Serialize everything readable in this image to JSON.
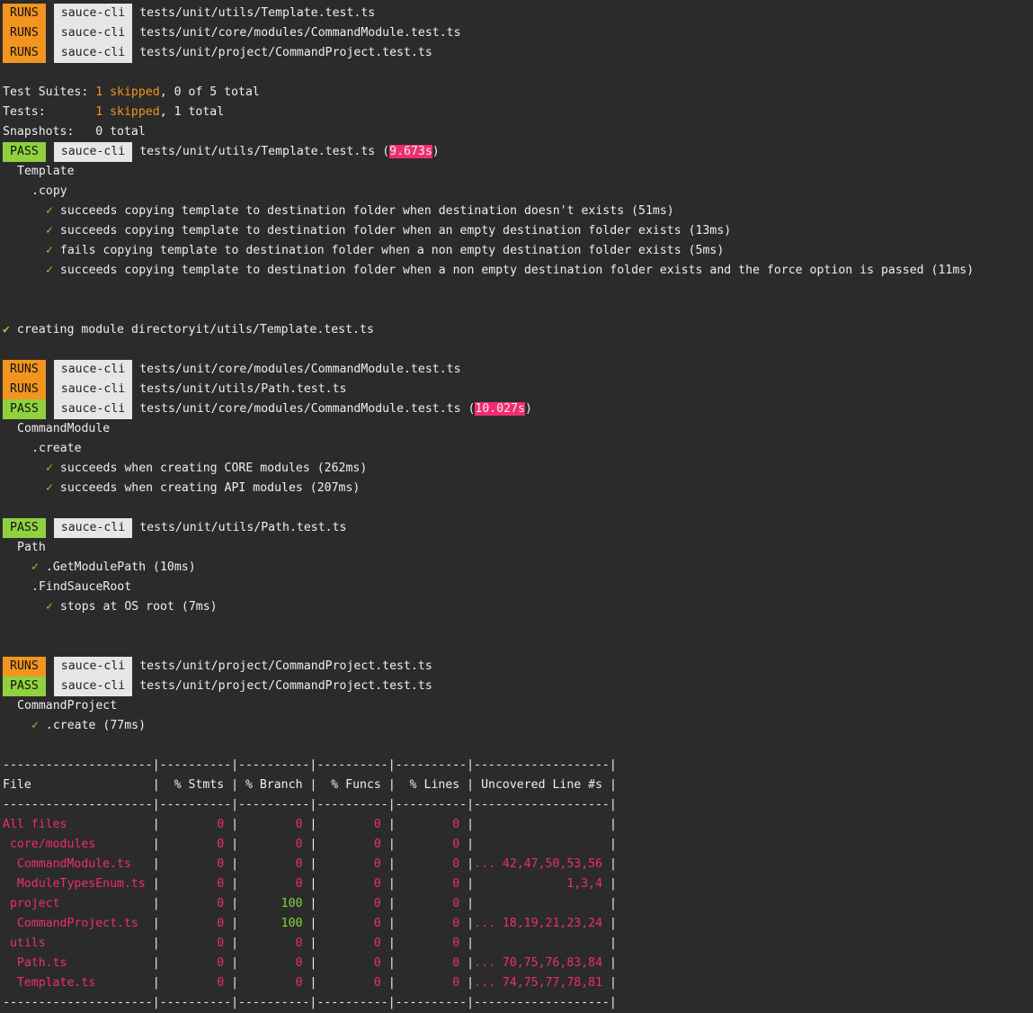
{
  "colors": {
    "runs": "#f2951f",
    "pass": "#8fd13f",
    "highlight": "#ef2d72",
    "background": "#2b2b2b"
  },
  "runs_label": "RUNS",
  "pass_label": "PASS",
  "project": "sauce-cli",
  "top_runs": [
    "tests/unit/utils/Template.test.ts",
    "tests/unit/core/modules/CommandModule.test.ts",
    "tests/unit/project/CommandProject.test.ts"
  ],
  "summary": {
    "suites_label": "Test Suites: ",
    "suites_skipped": "1 skipped",
    "suites_rest": ", 0 of 5 total",
    "tests_label": "Tests:       ",
    "tests_skipped": "1 skipped",
    "tests_rest": ", 1 total",
    "snapshots": "Snapshots:   0 total"
  },
  "template_suite": {
    "path": "tests/unit/utils/Template.test.ts",
    "time": "9.673s",
    "describe": "Template",
    "group": ".copy",
    "tests": [
      "succeeds copying template to destination folder when destination doesn't exists (51ms)",
      "succeeds copying template to destination folder when an empty destination folder exists (13ms)",
      "fails copying template to destination folder when a non empty destination folder exists (5ms)",
      "succeeds copying template to destination folder when a non empty destination folder exists and the force option is passed (11ms)"
    ]
  },
  "creating_check": "✔",
  "creating_line": "creating module directoryit/utils/Template.test.ts",
  "mid_runs": [
    "tests/unit/core/modules/CommandModule.test.ts",
    "tests/unit/utils/Path.test.ts"
  ],
  "command_module_suite": {
    "path": "tests/unit/core/modules/CommandModule.test.ts",
    "time": "10.027s",
    "describe": "CommandModule",
    "group": ".create",
    "tests": [
      "succeeds when creating CORE modules (262ms)",
      "succeeds when creating API modules (207ms)"
    ]
  },
  "path_suite": {
    "path": "tests/unit/utils/Path.test.ts",
    "describe": "Path",
    "test1": ".GetModulePath (10ms)",
    "group": ".FindSauceRoot",
    "test2": "stops at OS root (7ms)"
  },
  "command_project_runs": "tests/unit/project/CommandProject.test.ts",
  "command_project_suite": {
    "path": "tests/unit/project/CommandProject.test.ts",
    "describe": "CommandProject",
    "test": ".create (77ms)"
  },
  "check": "✓",
  "coverage": {
    "separator": "---------------------|----------|----------|----------|----------|-------------------|",
    "headers": [
      "File",
      "% Stmts",
      "% Branch",
      "% Funcs",
      "% Lines",
      "Uncovered Line #s"
    ],
    "rows": [
      {
        "file": "All files",
        "indent": "",
        "stmts": "0",
        "branch": "0",
        "funcs": "0",
        "lines": "0",
        "uncovered": ""
      },
      {
        "file": "core/modules",
        "indent": " ",
        "stmts": "0",
        "branch": "0",
        "funcs": "0",
        "lines": "0",
        "uncovered": ""
      },
      {
        "file": "CommandModule.ts",
        "indent": "  ",
        "stmts": "0",
        "branch": "0",
        "funcs": "0",
        "lines": "0",
        "uncovered": "... 42,47,50,53,56"
      },
      {
        "file": "ModuleTypesEnum.ts",
        "indent": "  ",
        "stmts": "0",
        "branch": "0",
        "funcs": "0",
        "lines": "0",
        "uncovered": "1,3,4"
      },
      {
        "file": "project",
        "indent": " ",
        "stmts": "0",
        "branch": "100",
        "funcs": "0",
        "lines": "0",
        "uncovered": ""
      },
      {
        "file": "CommandProject.ts",
        "indent": "  ",
        "stmts": "0",
        "branch": "100",
        "funcs": "0",
        "lines": "0",
        "uncovered": "... 18,19,21,23,24"
      },
      {
        "file": "utils",
        "indent": " ",
        "stmts": "0",
        "branch": "0",
        "funcs": "0",
        "lines": "0",
        "uncovered": ""
      },
      {
        "file": "Path.ts",
        "indent": "  ",
        "stmts": "0",
        "branch": "0",
        "funcs": "0",
        "lines": "0",
        "uncovered": "... 70,75,76,83,84"
      },
      {
        "file": "Template.ts",
        "indent": "  ",
        "stmts": "0",
        "branch": "0",
        "funcs": "0",
        "lines": "0",
        "uncovered": "... 74,75,77,78,81"
      }
    ]
  }
}
